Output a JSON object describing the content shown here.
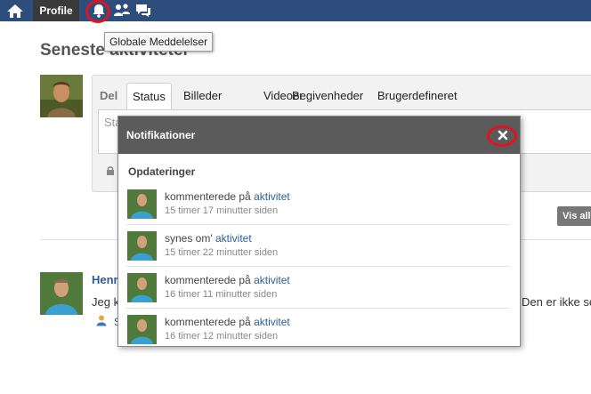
{
  "topbar": {
    "profile_label": "Profile"
  },
  "tooltip": {
    "text": "Globale Meddelelser"
  },
  "page": {
    "title": "Seneste aktiviteter"
  },
  "share": {
    "label": "Del",
    "tabs": [
      "Status",
      "Billeder",
      "Videoer",
      "Begivenheder",
      "Brugerdefineret"
    ],
    "placeholder": "Sta",
    "visible_button": "Vis alle"
  },
  "feed": {
    "name": "Henr",
    "text_left": "Jeg k",
    "text_right": "Den er ikke set",
    "small": "S"
  },
  "notifications": {
    "title": "Notifikationer",
    "section": "Opdateringer",
    "items": [
      {
        "action": "kommenterede på ",
        "link": "aktivitet",
        "time": "15 timer 17 minutter siden"
      },
      {
        "action": "synes om' ",
        "link": "aktivitet",
        "time": "15 timer 22 minutter siden"
      },
      {
        "action": "kommenterede på ",
        "link": "aktivitet",
        "time": "16 timer 11 minutter siden"
      },
      {
        "action": "kommenterede på ",
        "link": "aktivitet",
        "time": "16 timer 12 minutter siden"
      }
    ]
  },
  "colors": {
    "topbar": "#2d4e7d",
    "highlight_ring": "#e0141e",
    "link": "#2d5c99",
    "popup_header": "#5b5b5b"
  }
}
